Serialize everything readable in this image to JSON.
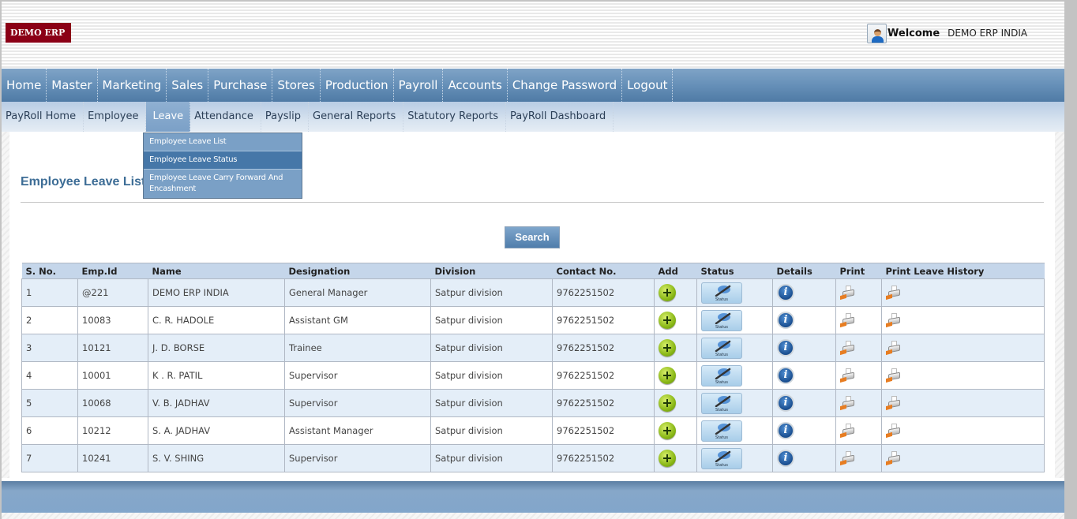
{
  "header": {
    "logo": "DEMO ERP",
    "welcome_label": "Welcome",
    "user_name": "DEMO ERP INDIA"
  },
  "main_nav": [
    {
      "label": "Home"
    },
    {
      "label": "Master"
    },
    {
      "label": "Marketing"
    },
    {
      "label": "Sales"
    },
    {
      "label": "Purchase"
    },
    {
      "label": "Stores"
    },
    {
      "label": "Production"
    },
    {
      "label": "Payroll"
    },
    {
      "label": "Accounts"
    },
    {
      "label": "Change Password"
    },
    {
      "label": "Logout"
    }
  ],
  "sub_nav": [
    {
      "label": "PayRoll Home"
    },
    {
      "label": "Employee"
    },
    {
      "label": "Leave",
      "active": true
    },
    {
      "label": "Attendance"
    },
    {
      "label": "Payslip"
    },
    {
      "label": "General Reports"
    },
    {
      "label": "Statutory Reports"
    },
    {
      "label": "PayRoll Dashboard"
    }
  ],
  "leave_dropdown": [
    {
      "label": "Employee Leave List"
    },
    {
      "label": "Employee Leave Status",
      "hovered": true
    },
    {
      "label": "Employee Leave Carry Forward And Encashment"
    }
  ],
  "page": {
    "title": "Employee Leave List",
    "search_label": "Search"
  },
  "table": {
    "columns": [
      "S. No.",
      "Emp.Id",
      "Name",
      "Designation",
      "Division",
      "Contact No.",
      "Add",
      "Status",
      "Details",
      "Print",
      "Print Leave History"
    ],
    "status_button_label": "Status",
    "icons": {
      "add": "plus-circle-icon",
      "status": "pen-status-icon",
      "details": "info-icon",
      "print": "printer-icon",
      "print_history": "printer-icon"
    },
    "rows": [
      {
        "sno": "1",
        "emp_id": "@221",
        "name": "DEMO ERP INDIA",
        "designation": "General Manager",
        "division": "Satpur division",
        "contact": "9762251502"
      },
      {
        "sno": "2",
        "emp_id": "10083",
        "name": "C. R. HADOLE",
        "designation": "Assistant GM",
        "division": "Satpur division",
        "contact": "9762251502"
      },
      {
        "sno": "3",
        "emp_id": "10121",
        "name": "J. D. BORSE",
        "designation": "Trainee",
        "division": "Satpur division",
        "contact": "9762251502"
      },
      {
        "sno": "4",
        "emp_id": "10001",
        "name": "K . R. PATIL",
        "designation": "Supervisor",
        "division": "Satpur division",
        "contact": "9762251502"
      },
      {
        "sno": "5",
        "emp_id": "10068",
        "name": "V. B. JADHAV",
        "designation": "Supervisor",
        "division": "Satpur division",
        "contact": "9762251502"
      },
      {
        "sno": "6",
        "emp_id": "10212",
        "name": "S. A. JADHAV",
        "designation": "Assistant Manager",
        "division": "Satpur division",
        "contact": "9762251502"
      },
      {
        "sno": "7",
        "emp_id": "10241",
        "name": "S. V. SHING",
        "designation": "Supervisor",
        "division": "Satpur division",
        "contact": "9762251502"
      }
    ]
  }
}
